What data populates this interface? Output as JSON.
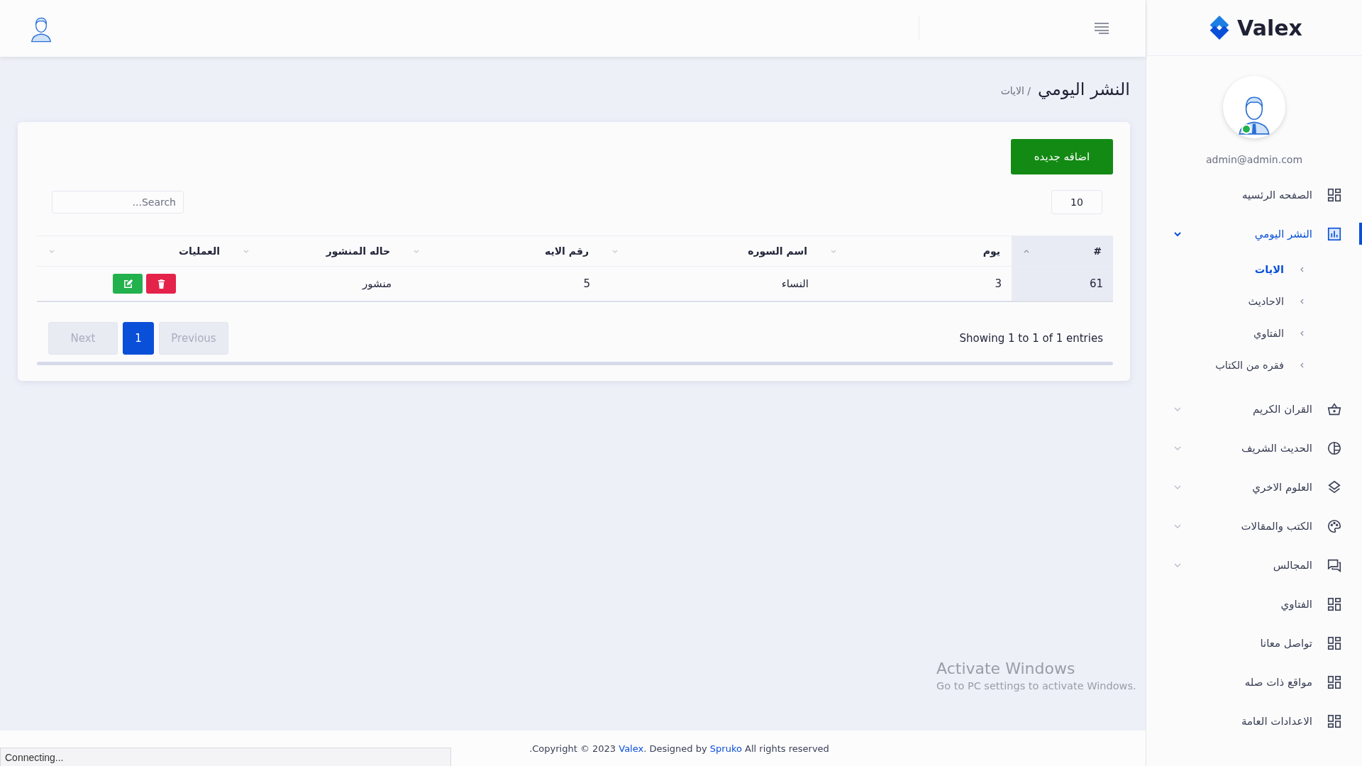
{
  "brand": {
    "name": "Valex"
  },
  "user": {
    "email": "admin@admin.com",
    "online": true
  },
  "nav": [
    {
      "kind": "link",
      "label": "الصفحه الرئسيه",
      "selected": false
    },
    {
      "kind": "group",
      "label": "النشر اليومي",
      "selected": true,
      "expanded": true,
      "children": [
        {
          "label": "الايات",
          "selected": true
        },
        {
          "label": "الاحاديث",
          "selected": false
        },
        {
          "label": "الفتاوي",
          "selected": false
        },
        {
          "label": "فقره من الكتاب",
          "selected": false
        }
      ]
    },
    {
      "kind": "group",
      "label": "القران الكريم",
      "selected": false,
      "expanded": false
    },
    {
      "kind": "group",
      "label": "الحديث الشريف",
      "selected": false,
      "expanded": false
    },
    {
      "kind": "group",
      "label": "العلوم الاخري",
      "selected": false,
      "expanded": false
    },
    {
      "kind": "group",
      "label": "الكتب والمقالات",
      "selected": false,
      "expanded": false
    },
    {
      "kind": "group",
      "label": "المجالس",
      "selected": false,
      "expanded": false
    },
    {
      "kind": "link",
      "label": "الفتاوي",
      "selected": false
    },
    {
      "kind": "link",
      "label": "تواصل معانا",
      "selected": false
    },
    {
      "kind": "link",
      "label": "مواقع ذات صله",
      "selected": false
    },
    {
      "kind": "link",
      "label": "الاعدادات العامة",
      "selected": false
    }
  ],
  "page": {
    "title": "النشر اليومي",
    "breadcrumb": "/ الايات"
  },
  "add_button": "اضافه جديده",
  "page_length": "10",
  "search": {
    "placeholder": "Search..."
  },
  "table": {
    "columns": [
      {
        "label": "#",
        "sorted": true
      },
      {
        "label": "يوم",
        "sorted": false
      },
      {
        "label": "اسم السوره",
        "sorted": false
      },
      {
        "label": "رقم الايه",
        "sorted": false
      },
      {
        "label": "حاله المنشور",
        "sorted": false
      },
      {
        "label": "العمليات",
        "sorted": false
      }
    ],
    "rows": [
      {
        "cells": [
          "61",
          "3",
          "النساء",
          "5",
          "منشور"
        ]
      }
    ]
  },
  "info": "Showing 1 to 1 of 1 entries",
  "pagination": {
    "previous": {
      "label": "Previous",
      "disabled": true
    },
    "pages": [
      {
        "label": "1",
        "selected": true
      }
    ],
    "next": {
      "label": "Next",
      "disabled": true
    }
  },
  "footer": {
    "before": ".Copyright © 2023 ",
    "brand_link": "Valex",
    "middle": ". Designed by ",
    "author_link": "Spruko",
    "after": " All rights reserved"
  },
  "status_bar": "Connecting...",
  "os_notice": {
    "title": "Activate Windows",
    "text": "Go to PC settings to activate Windows."
  }
}
